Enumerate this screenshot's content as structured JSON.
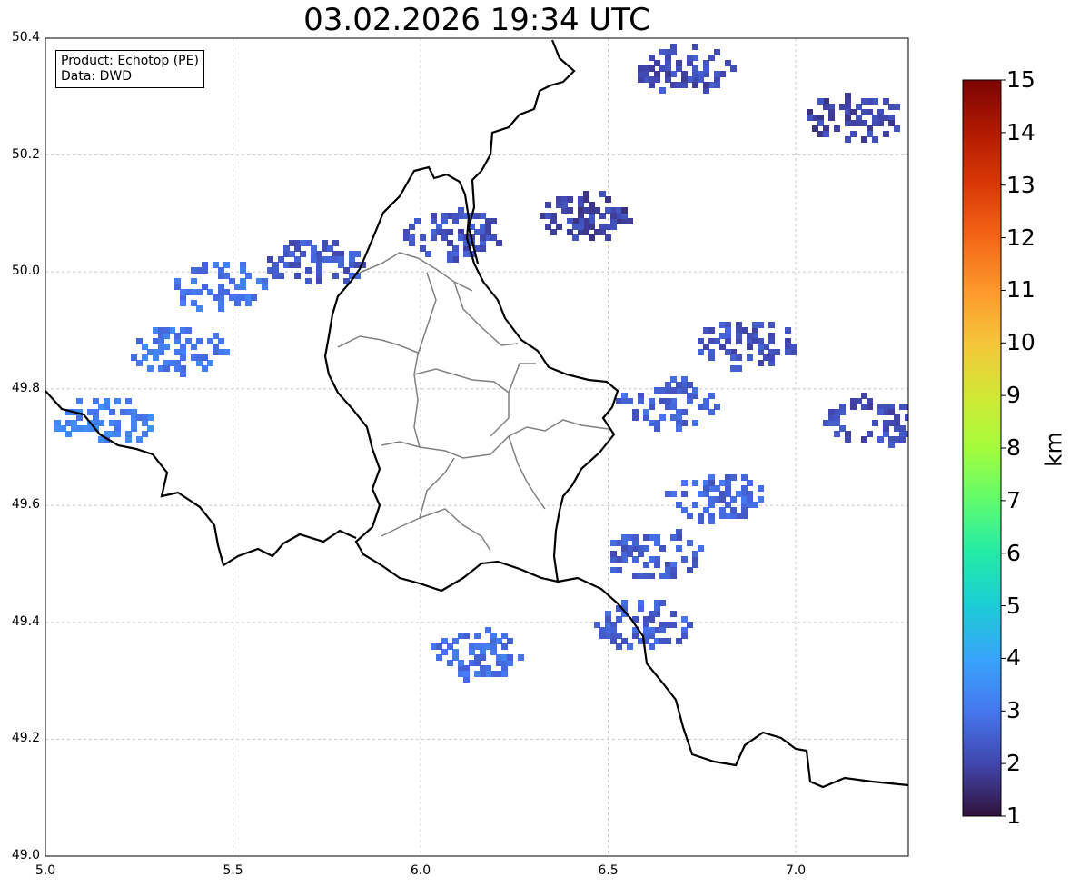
{
  "title": "03.02.2026 19:34 UTC",
  "info": {
    "product": "Product: Echotop (PE)",
    "data_source": "Data: DWD"
  },
  "map": {
    "lon_range": [
      5.0,
      7.3
    ],
    "lat_range": [
      49.0,
      50.4
    ],
    "x_ticks": [
      "5.0",
      "5.5",
      "6.0",
      "6.5",
      "7.0"
    ],
    "y_ticks": [
      "49.0",
      "49.2",
      "49.4",
      "49.6",
      "49.8",
      "50.0",
      "50.2",
      "50.4"
    ],
    "gridlines": true
  },
  "colorbar": {
    "label": "km",
    "ticks": [
      "1",
      "2",
      "3",
      "4",
      "5",
      "6",
      "7",
      "8",
      "9",
      "10",
      "11",
      "12",
      "13",
      "14",
      "15"
    ],
    "range": [
      1,
      15
    ],
    "colormap": "turbo"
  },
  "colors": {
    "border": "#000000",
    "district_border": "#808080",
    "grid": "#c8c8c8"
  },
  "echo_cells": [
    {
      "lon": 5.15,
      "lat": 49.75,
      "value": 3.3
    },
    {
      "lon": 5.35,
      "lat": 49.87,
      "value": 3.1
    },
    {
      "lon": 5.45,
      "lat": 49.98,
      "value": 3.0
    },
    {
      "lon": 5.72,
      "lat": 50.02,
      "value": 2.4
    },
    {
      "lon": 6.08,
      "lat": 50.07,
      "value": 2.3
    },
    {
      "lon": 6.42,
      "lat": 50.1,
      "value": 2.0
    },
    {
      "lon": 6.7,
      "lat": 50.35,
      "value": 2.2
    },
    {
      "lon": 7.15,
      "lat": 50.27,
      "value": 2.0
    },
    {
      "lon": 6.65,
      "lat": 49.78,
      "value": 2.6
    },
    {
      "lon": 6.86,
      "lat": 49.88,
      "value": 2.3
    },
    {
      "lon": 7.2,
      "lat": 49.75,
      "value": 2.2
    },
    {
      "lon": 6.78,
      "lat": 49.62,
      "value": 2.7
    },
    {
      "lon": 6.62,
      "lat": 49.52,
      "value": 2.5
    },
    {
      "lon": 6.58,
      "lat": 49.4,
      "value": 2.6
    },
    {
      "lon": 6.15,
      "lat": 49.35,
      "value": 2.9
    }
  ]
}
